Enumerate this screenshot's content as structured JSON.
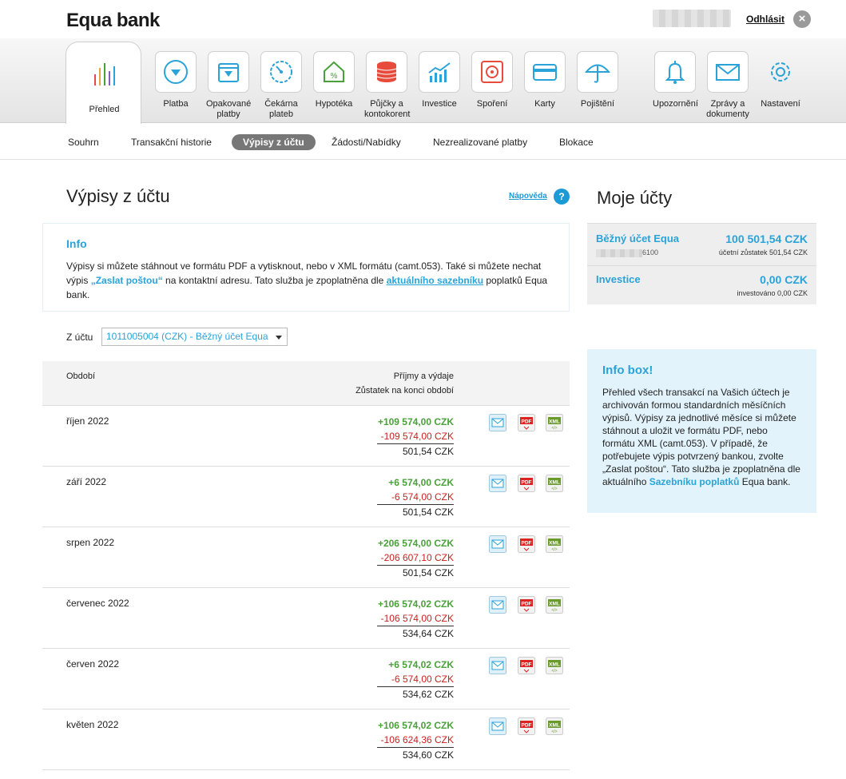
{
  "header": {
    "logo": "Equa bank",
    "logout": "Odhlásit"
  },
  "nav": {
    "active": "Přehled",
    "items": [
      {
        "label": "Platba",
        "icon": "payment-icon"
      },
      {
        "label": "Opakované platby",
        "icon": "recurring-payment-icon"
      },
      {
        "label": "Čekárna plateb",
        "icon": "waiting-payments-icon"
      },
      {
        "label": "Hypotéka",
        "icon": "mortgage-icon"
      },
      {
        "label": "Půjčky a kontokorent",
        "icon": "loans-icon"
      },
      {
        "label": "Investice",
        "icon": "investments-icon"
      },
      {
        "label": "Spoření",
        "icon": "savings-icon"
      },
      {
        "label": "Karty",
        "icon": "cards-icon"
      },
      {
        "label": "Pojištění",
        "icon": "insurance-icon"
      },
      {
        "label": "Upozornění",
        "icon": "bell-icon"
      },
      {
        "label": "Zprávy a dokumenty",
        "icon": "envelope-icon"
      },
      {
        "label": "Nastavení",
        "icon": "gear-icon"
      }
    ]
  },
  "subtabs": [
    "Souhrn",
    "Transakční historie",
    "Výpisy z účtu",
    "Žádosti/Nabídky",
    "Nezrealizované platby",
    "Blokace"
  ],
  "main": {
    "title": "Výpisy z účtu",
    "help": "Nápověda",
    "info_title": "Info",
    "info_text_1": "Výpisy si můžete stáhnout ve formátu PDF a vytisknout, nebo v XML formátu (camt.053). Také si můžete nechat výpis ",
    "info_highlight": "„Zaslat poštou“",
    "info_text_2": " na kontaktní adresu. Tato služba je zpoplatněna dle ",
    "info_link": "aktuálního sazebníku",
    "info_text_3": " poplatků Equa bank.",
    "account_label": "Z účtu",
    "account_value": "1011005004 (CZK) - Běžný účet Equa",
    "col_period": "Období",
    "col_flows": "Příjmy a výdaje",
    "col_balance": "Zůstatek na konci období",
    "rows": [
      {
        "period": "říjen 2022",
        "income": "+109 574,00 CZK",
        "expense": "-109 574,00 CZK",
        "balance": "501,54 CZK"
      },
      {
        "period": "září 2022",
        "income": "+6 574,00 CZK",
        "expense": "-6 574,00 CZK",
        "balance": "501,54 CZK"
      },
      {
        "period": "srpen 2022",
        "income": "+206 574,00 CZK",
        "expense": "-206 607,10 CZK",
        "balance": "501,54 CZK"
      },
      {
        "period": "červenec 2022",
        "income": "+106 574,02 CZK",
        "expense": "-106 574,00 CZK",
        "balance": "534,64 CZK"
      },
      {
        "period": "červen 2022",
        "income": "+6 574,02 CZK",
        "expense": "-6 574,00 CZK",
        "balance": "534,62 CZK"
      },
      {
        "period": "květen 2022",
        "income": "+106 574,02 CZK",
        "expense": "-106 624,36 CZK",
        "balance": "534,60 CZK"
      }
    ]
  },
  "side": {
    "title": "Moje účty",
    "accounts": [
      {
        "name": "Běžný účet Equa",
        "amount": "100 501,54 CZK",
        "number_suffix": "6100",
        "sub": "účetní zůstatek 501,54 CZK"
      },
      {
        "name": "Investice",
        "amount": "0,00 CZK",
        "sub": "investováno 0,00 CZK"
      }
    ],
    "info_title": "Info box!",
    "info_text_1": "Přehled všech transakcí na Vašich účtech je archivován formou standardních měsíčních výpisů. Výpisy za jednotlivé měsíce si můžete stáhnout a uložit ve formátu PDF, nebo formátu XML (camt.053). V případě, že potřebujete výpis potvrzený bankou, zvolte „Zaslat poštou“. Tato služba je zpoplatněna dle aktuálního ",
    "info_link": "Sazebníku poplatků",
    "info_text_2": " Equa bank."
  },
  "colors": {
    "accent": "#2aa3d8",
    "income": "#4aa13a",
    "expense": "#cc1e1e"
  }
}
